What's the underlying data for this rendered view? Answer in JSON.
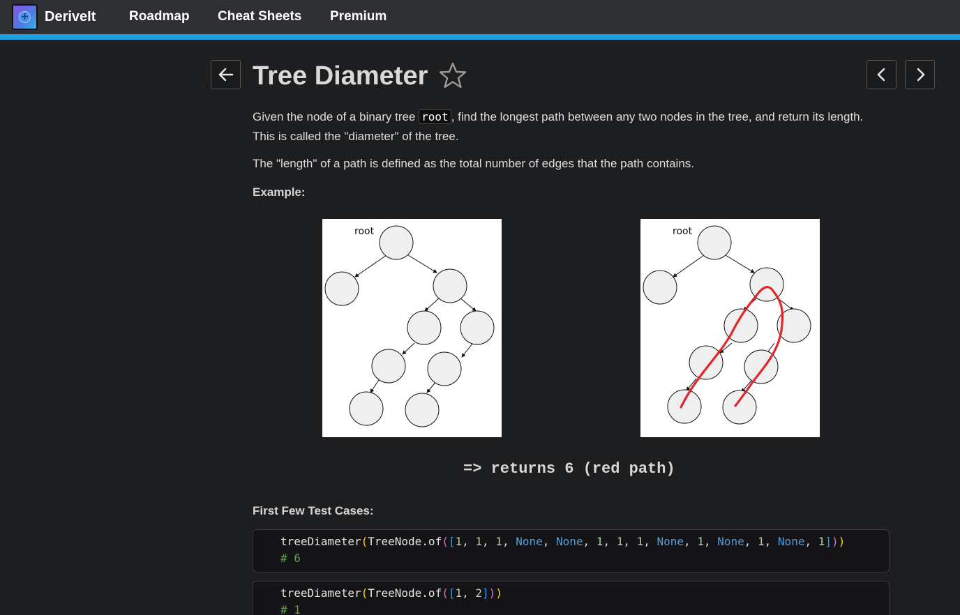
{
  "nav": {
    "brand": "DeriveIt",
    "items": [
      "Roadmap",
      "Cheat Sheets",
      "Premium"
    ]
  },
  "problem": {
    "title": "Tree Diameter",
    "description_before": "Given the node of a binary tree ",
    "description_code": "root",
    "description_after": ", find the longest path between any two nodes in the tree, and return its length. This is called the \"diameter\" of the tree.",
    "length_definition": "The \"length\" of a path is defined as the total number of edges that the path contains.",
    "example_label": "Example:",
    "figure_root_label": "root",
    "result_text": "=> returns 6 (red path)",
    "test_cases_label": "First Few Test Cases:"
  },
  "test_cases": [
    {
      "fn": "treeDiameter",
      "ctor": "TreeNode.of",
      "args": [
        "1",
        "1",
        "1",
        "None",
        "None",
        "1",
        "1",
        "1",
        "None",
        "1",
        "None",
        "1",
        "None",
        "1"
      ],
      "result": "# 6"
    },
    {
      "fn": "treeDiameter",
      "ctor": "TreeNode.of",
      "args": [
        "1",
        "2"
      ],
      "result": "# 1"
    }
  ],
  "colors": {
    "accent": "#1ba1e2",
    "topbar": "#2e2f33",
    "background": "#1d1e20",
    "path_red": "#e0262d"
  },
  "icons": {
    "back": "arrow-left-icon",
    "favorite": "star-outline-icon",
    "prev": "chevron-left-icon",
    "next": "chevron-right-icon"
  }
}
